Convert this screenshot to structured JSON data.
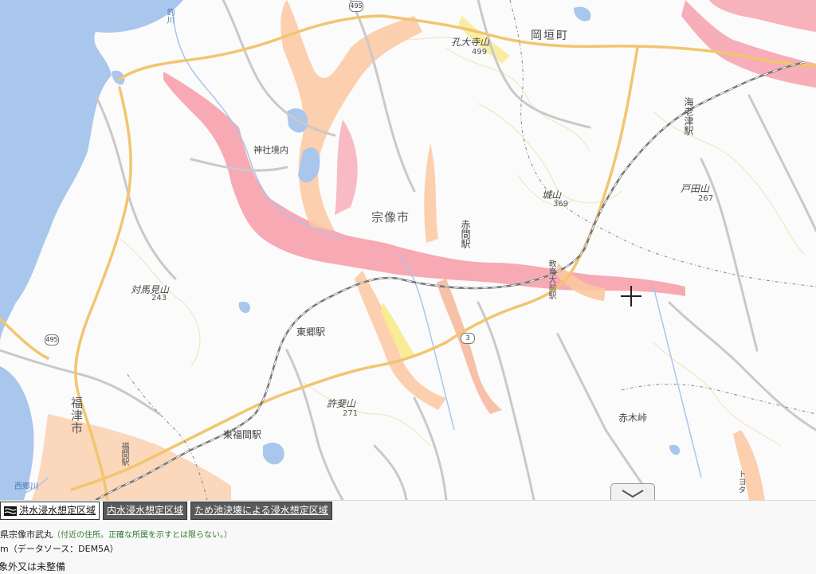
{
  "map": {
    "labels": {
      "town_okagaki": "岡垣町",
      "city_munakata": "宗像市",
      "city_fukutsu": "福津市",
      "shrine": "神社境内",
      "mt_nodaiji": "孔大寺山",
      "mt_nodaiji_elev": "499",
      "mt_joyama": "城山",
      "mt_joyama_elev": "369",
      "mt_todayama": "戸田山",
      "mt_todayama_elev": "267",
      "mt_tsushimami": "対馬見山",
      "mt_tsushimami_elev": "243",
      "mt_kyorai": "許斐山",
      "mt_kyorai_elev": "271",
      "st_akama": "赤間駅",
      "st_togo": "東郷駅",
      "st_higashifukuma": "東福間駅",
      "st_fukuma": "福間駅",
      "st_ebitsu": "海老津駅",
      "st_kyoiku": "教育大前駅",
      "pass_akagi": "赤木峠",
      "river_nishigo": "西郷川",
      "river_tsuri": "釣川",
      "toyota": "トヨタ"
    },
    "routes": {
      "r495_top": "495",
      "r495_left": "495",
      "r3": "3"
    }
  },
  "panel": {
    "tabs": [
      {
        "label": "洪水浸水想定区域",
        "active": true
      },
      {
        "label": "内水浸水想定区域",
        "active": false
      },
      {
        "label": "ため池決壊による浸水想定区域",
        "active": false
      }
    ],
    "address": "県宗像市武丸",
    "address_note": "（付近の住所。正確な所属を示すとは限らない。）",
    "elevation_line": "m（データソース：DEM5A）",
    "status_line": "対象外又は未整備"
  },
  "colors": {
    "flood_pink": "#f49aa8",
    "flood_orange": "#fbc7a0",
    "flood_yellow": "#f8ea8c",
    "sea": "#a9c6ec",
    "road_main": "#f2c56f"
  }
}
